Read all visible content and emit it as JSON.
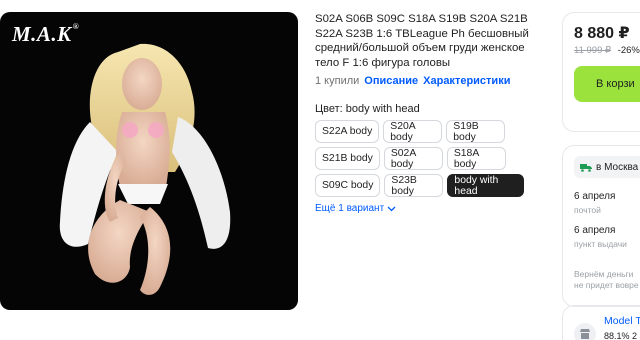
{
  "product": {
    "brand": "M.A.K",
    "brand_mark": "®",
    "title": "S02A S06B S09C S18A S19B S20A S21B S22A S23B 1:6 TBLeague Ph бесшовный средний/большой объем груди женское тело F 1:6 фигура головы",
    "purchases": "1 купили",
    "description_link": "Описание",
    "specs_link": "Характеристики"
  },
  "variants": {
    "label": "Цвет: body with head",
    "options": [
      "S22A body",
      "S20A body",
      "S19B body",
      "S21B body",
      "S02A body",
      "S18A body",
      "S09C body",
      "S23B body",
      "body with head"
    ],
    "selected": "body with head",
    "more": "Ещё 1 вариант"
  },
  "buybox": {
    "price": "8 880 ₽",
    "old_price": "11 999 ₽",
    "discount": "-26%",
    "cart_button": "В корзи"
  },
  "delivery": {
    "location": "в Москва",
    "options": [
      {
        "date": "6 апреля",
        "method": "почтой"
      },
      {
        "date": "6 апреля",
        "method": "пункт выдачи"
      }
    ],
    "return_note_1": "Вернём деньги",
    "return_note_2": "не придет вовре"
  },
  "seller": {
    "name": "Model T",
    "rating": "88.1% 2"
  },
  "colors": {
    "accent": "#005bff",
    "cart_green": "#9be23d",
    "selected_chip": "#1f1f1f"
  }
}
